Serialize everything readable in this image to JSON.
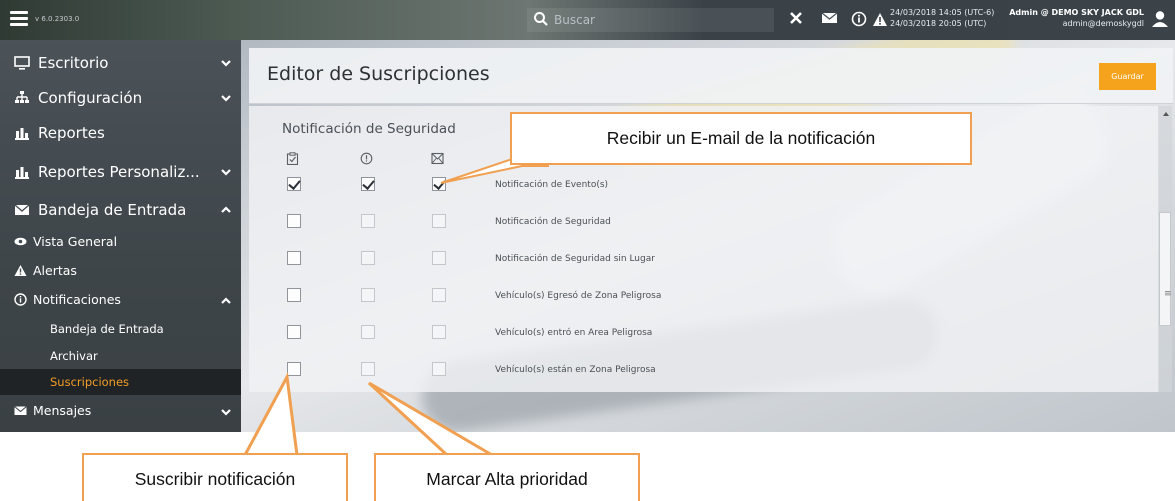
{
  "topbar": {
    "version": "v 6.0.2303.0",
    "search_placeholder": "Buscar",
    "date_local": "24/03/2018 14:05 (UTC-6)",
    "date_utc": "24/03/2018 20:05 (UTC)",
    "user_name": "Admin @ DEMO SKY JACK GDL",
    "user_email": "admin@demoskygdl"
  },
  "sidebar": {
    "items": [
      {
        "label": "Escritorio",
        "icon": "monitor-icon"
      },
      {
        "label": "Configuración",
        "icon": "sitemap-icon"
      },
      {
        "label": "Reportes",
        "icon": "bar-chart-icon"
      },
      {
        "label": "Reportes Personaliz...",
        "icon": "bar-chart-icon"
      },
      {
        "label": "Bandeja de Entrada",
        "icon": "envelope-icon"
      }
    ],
    "inbox_children": [
      {
        "label": "Vista General",
        "icon": "eye-icon"
      },
      {
        "label": "Alertas",
        "icon": "warning-icon"
      },
      {
        "label": "Notificaciones",
        "icon": "info-circle-icon"
      }
    ],
    "notif_children": [
      {
        "label": "Bandeja de Entrada"
      },
      {
        "label": "Archivar"
      },
      {
        "label": "Suscripciones"
      }
    ],
    "mensajes_label": "Mensajes",
    "active_color": "#f39c25"
  },
  "content": {
    "title": "Editor de Suscripciones",
    "save_label": "Guardar",
    "section_title": "Notificación de Seguridad",
    "columns": [
      {
        "icon": "clipboard-check-icon",
        "meaning": "subscribe"
      },
      {
        "icon": "exclamation-circle-icon",
        "meaning": "high-priority"
      },
      {
        "icon": "envelope-box-icon",
        "meaning": "email"
      }
    ],
    "rows": [
      {
        "label": "Notificación de Evento(s)",
        "subscribe": true,
        "priority": true,
        "email": true
      },
      {
        "label": "Notificación de Seguridad",
        "subscribe": false,
        "priority": false,
        "email": false
      },
      {
        "label": "Notificación de Seguridad sin Lugar",
        "subscribe": false,
        "priority": false,
        "email": false
      },
      {
        "label": "Vehículo(s) Egresó de Zona Peligrosa",
        "subscribe": false,
        "priority": false,
        "email": false
      },
      {
        "label": "Vehículo(s) entró en Area Peligrosa",
        "subscribe": false,
        "priority": false,
        "email": false
      },
      {
        "label": "Vehículo(s) están en Zona Peligrosa",
        "subscribe": false,
        "priority": false,
        "email": false
      }
    ],
    "accent_color": "#f5a21c"
  },
  "callouts": {
    "email": "Recibir un E-mail de la notificación",
    "subscribe": "Suscribir notificación",
    "priority": "Marcar Alta prioridad",
    "color": "#f0a050"
  }
}
